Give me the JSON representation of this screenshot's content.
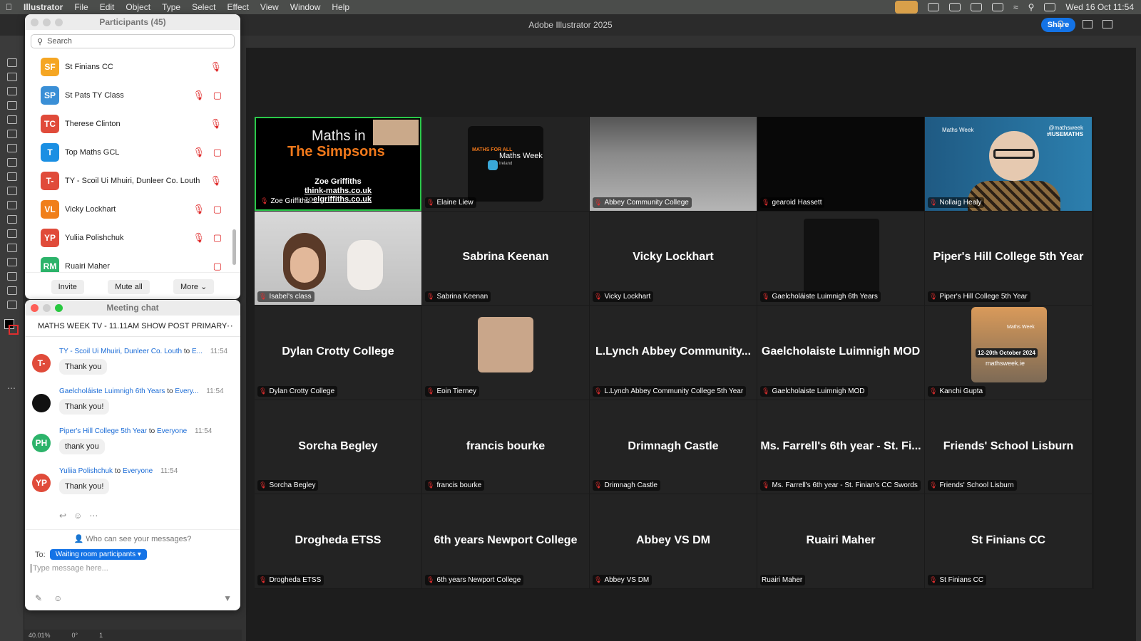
{
  "menubar": {
    "app": "Illustrator",
    "items": [
      "File",
      "Edit",
      "Object",
      "Type",
      "Select",
      "Effect",
      "View",
      "Window",
      "Help"
    ],
    "datetime": "Wed 16 Oct  11:54"
  },
  "window": {
    "title": "Adobe Illustrator 2025",
    "share": "Share"
  },
  "statusbar": {
    "zoom": "40.01%",
    "rotation": "0°",
    "page": "1"
  },
  "participants": {
    "title": "Participants (45)",
    "search_placeholder": "Search",
    "list": [
      {
        "initials": "SF",
        "name": "St Finians CC",
        "color": "#f5a623",
        "video_off": false
      },
      {
        "initials": "SP",
        "name": "St Pats TY Class",
        "color": "#3a8fd6",
        "video_off": true
      },
      {
        "initials": "TC",
        "name": "Therese Clinton",
        "color": "#e04b3a",
        "video_off": false
      },
      {
        "initials": "T",
        "name": "Top Maths GCL",
        "color": "#1a8fe3",
        "video_off": true
      },
      {
        "initials": "T-",
        "name": "TY - Scoil Ui Mhuiri, Dunleer Co. Louth",
        "color": "#e04b3a",
        "video_off": false
      },
      {
        "initials": "VL",
        "name": "Vicky Lockhart",
        "color": "#f07f1a",
        "video_off": true
      },
      {
        "initials": "YP",
        "name": "Yuliia Polishchuk",
        "color": "#e04b3a",
        "video_off": true
      },
      {
        "initials": "RM",
        "name": "Ruairi Maher",
        "color": "#2cb36a",
        "video_off": true,
        "no_mic": true
      }
    ],
    "buttons": {
      "invite": "Invite",
      "mute_all": "Mute all",
      "more": "More"
    }
  },
  "chat": {
    "title": "Meeting chat",
    "meeting": "MATHS WEEK TV - 11.11AM SHOW POST PRIMARY",
    "messages": [
      {
        "initials": "T-",
        "color": "#e04b3a",
        "from": "TY - Scoil Ui Mhuiri, Dunleer Co. Louth",
        "to": "E...",
        "time": "11:54",
        "text": "Thank you"
      },
      {
        "initials": "",
        "color": "#111111",
        "from": "Gaelcholáiste Luimnigh 6th Years",
        "to": "Every...",
        "time": "11:54",
        "text": "Thank you!"
      },
      {
        "initials": "PH",
        "color": "#2cb36a",
        "from": "Piper's Hill College 5th Year",
        "to": "Everyone",
        "time": "11:54",
        "text": "thank you"
      },
      {
        "initials": "YP",
        "color": "#e04b3a",
        "from": "Yuliia Polishchuk",
        "to": "Everyone",
        "time": "11:54",
        "text": "Thank you!"
      }
    ],
    "to_word": "to",
    "who_can_see": "Who can see your messages?",
    "to_label": "To:",
    "recipient": "Waiting room participants",
    "placeholder": "Type message here..."
  },
  "gallery": {
    "tiles": [
      {
        "label": "Zoe Griffiths",
        "big": "",
        "active": true,
        "kind": "slide"
      },
      {
        "label": "Elaine Liew",
        "big": "",
        "kind": "logo"
      },
      {
        "label": "Abbey Community College",
        "big": "",
        "kind": "room"
      },
      {
        "label": "gearoid Hassett",
        "big": "",
        "kind": "black"
      },
      {
        "label": "Nollaig Healy",
        "big": "",
        "kind": "person"
      },
      {
        "label": "Isabel's class",
        "big": "",
        "kind": "class"
      },
      {
        "label": "Sabrina Keenan",
        "big": "Sabrina Keenan"
      },
      {
        "label": "Vicky Lockhart",
        "big": "Vicky Lockhart"
      },
      {
        "label": "Gaelcholáiste Luimnigh 6th Years",
        "big": "",
        "kind": "square"
      },
      {
        "label": "Piper's Hill College 5th Year",
        "big": "Piper's Hill College 5th Year"
      },
      {
        "label": "Dylan Crotty College",
        "big": "Dylan Crotty College"
      },
      {
        "label": "Eoin Tierney",
        "big": "",
        "kind": "avatar"
      },
      {
        "label": "L.Lynch Abbey Community College 5th Year",
        "big": "L.Lynch Abbey Community..."
      },
      {
        "label": "Gaelcholaiste Luimnigh MOD",
        "big": "Gaelcholaiste Luimnigh MOD"
      },
      {
        "label": "Kanchi Gupta",
        "big": "",
        "kind": "poster"
      },
      {
        "label": "Sorcha Begley",
        "big": "Sorcha Begley"
      },
      {
        "label": "francis bourke",
        "big": "francis bourke"
      },
      {
        "label": "Drimnagh Castle",
        "big": "Drimnagh Castle"
      },
      {
        "label": "Ms. Farrell's 6th year - St. Finian's CC Swords",
        "big": "Ms. Farrell's 6th year - St. Fi..."
      },
      {
        "label": "Friends' School Lisburn",
        "big": "Friends' School Lisburn"
      },
      {
        "label": "Drogheda ETSS",
        "big": "Drogheda ETSS"
      },
      {
        "label": "6th years Newport College",
        "big": "6th years Newport College"
      },
      {
        "label": "Abbey VS DM",
        "big": "Abbey VS DM"
      },
      {
        "label": "Ruairi Maher",
        "big": "Ruairi Maher",
        "no_mic": true
      },
      {
        "label": "St Finians CC",
        "big": "St Finians CC"
      }
    ],
    "slide": {
      "line1": "Maths in",
      "line2": "The Simpsons",
      "name": "Zoe Griffiths",
      "site1": "think-maths.co.uk",
      "site2": "zoelgriffiths.co.uk"
    },
    "logo": {
      "text": "Maths Week",
      "sub": "Ireland",
      "arc": "MATHS FOR ALL"
    },
    "person_banner": {
      "handle": "@mathsweek",
      "tag": "#IUSEMATHS",
      "logo": "Maths Week"
    },
    "poster": {
      "dates": "12-20th October 2024",
      "site": "mathsweek.ie",
      "logo": "Maths Week"
    }
  }
}
